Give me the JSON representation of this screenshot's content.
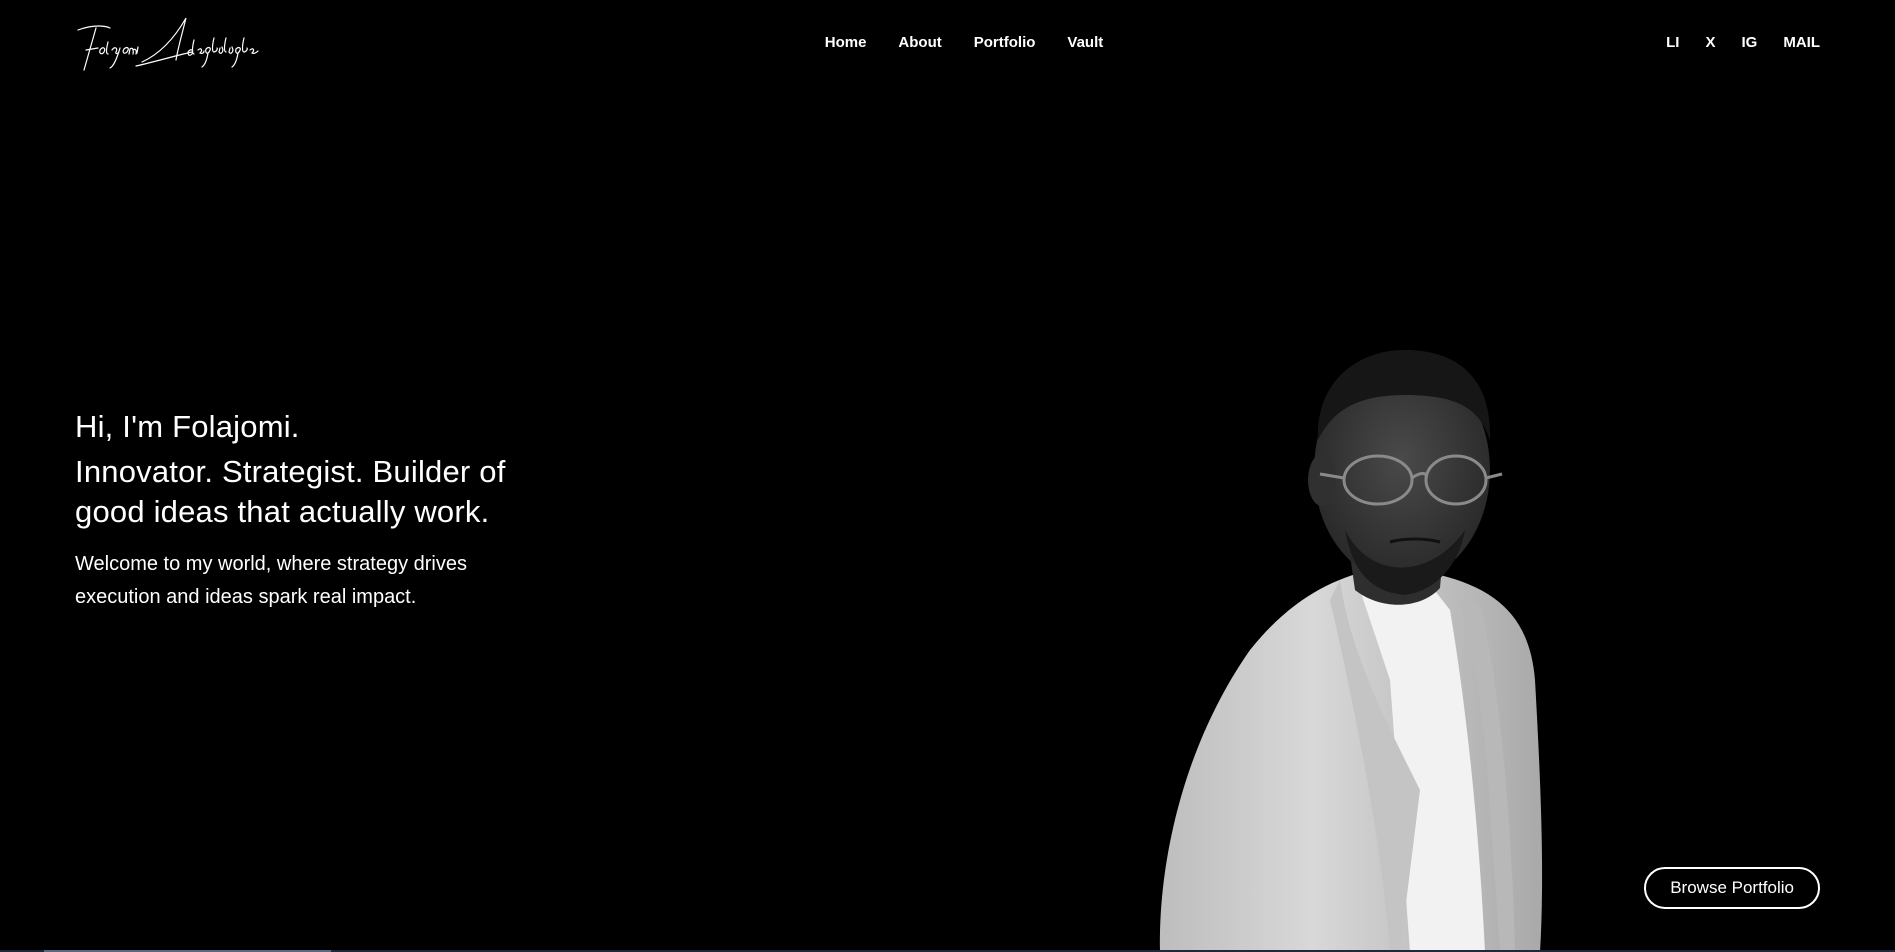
{
  "header": {
    "logo_text": "Folajomi Adegbulugbe",
    "nav": [
      {
        "label": "Home"
      },
      {
        "label": "About"
      },
      {
        "label": "Portfolio"
      },
      {
        "label": "Vault"
      }
    ],
    "social": [
      {
        "label": "LI"
      },
      {
        "label": "X"
      },
      {
        "label": "IG"
      },
      {
        "label": "MAIL"
      }
    ]
  },
  "hero": {
    "greeting": "Hi, I'm Folajomi.",
    "tagline": "Innovator. Strategist. Builder of good ideas that actually work.",
    "subtitle": "Welcome to my world, where strategy drives execution and ideas spark real impact."
  },
  "cta": {
    "label": "Browse Portfolio"
  },
  "colors": {
    "background": "#000000",
    "text": "#ffffff"
  }
}
